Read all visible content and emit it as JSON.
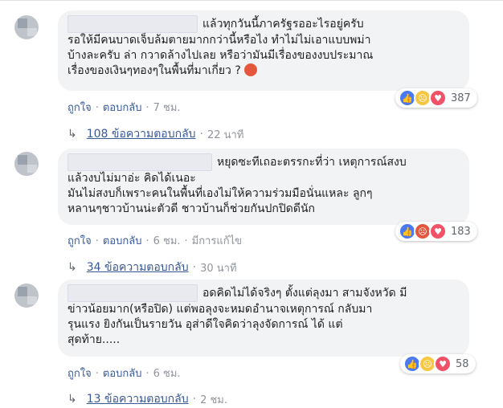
{
  "comments": [
    {
      "text": "แล้วทุกวันนี้ภาครัฐรออะไรอยู่ครับ\nรอให้มีคนบาดเจ็บล้มตายมากกว่านี้หรือไง ทำไม่ไม่เอาแบบพม่า\nบ้างละครับ ล่า กวาดล้างไปเลย หรือว่ามันมีเรื่องของงบประมาณ\nเรื่องของเงินๆทองๆในพื้นที่มาเกี่ยว ?",
      "like_label": "ถูกใจ",
      "reply_label": "ตอบกลับ",
      "time": "7 ชม.",
      "reaction_icons": [
        "like-icon",
        "sad-icon",
        "love-icon"
      ],
      "reaction_count": "387",
      "replies_label": "108 ข้อความตอบกลับ",
      "replies_time": "22 นาที"
    },
    {
      "text": "หยุดซะทีเถอะตรรกะที่ว่า เหตุการณ์สงบ\nแล้วงบไม่มาอ่ะ คิดได้เนอะ\nมันไม่สงบก็เพราะคนในพื้นที่เองไม่ให้ความร่วมมือนั่นแหละ ลูกๆ\nหลานๆชาวบ้านน่ะตัวดี ชาวบ้านก็ช่วยกันปกปิดดีนัก",
      "like_label": "ถูกใจ",
      "reply_label": "ตอบกลับ",
      "time": "6 ชม.",
      "edited_label": "มีการแก้ไข",
      "reaction_icons": [
        "like-icon",
        "angry-icon",
        "love-icon"
      ],
      "reaction_count": "183",
      "replies_label": "34 ข้อความตอบกลับ",
      "replies_time": "30 นาที"
    },
    {
      "text": "อดคิดไม่ได้จริงๆ ตั้งแต่ลุงมา สามจังหวัด มี\nข่าวน้อยมาก(หรือปิด) แต่พอลุงจะหมดอำนาจเหตุการณ์ กลับมา\nรุนแรง ยิงกันเป็นรายวัน อุส่าดีใจคิดว่าลุงจัดการณ์ ได้ แต่\nสุดท้าย.....",
      "like_label": "ถูกใจ",
      "reply_label": "ตอบกลับ",
      "time": "6 ชม.",
      "reaction_icons": [
        "like-icon",
        "sad-icon",
        "love-icon"
      ],
      "reaction_count": "58",
      "replies_label": "13 ข้อความตอบกลับ",
      "replies_time": "2 ชม."
    }
  ],
  "colors": {
    "link": "#385898",
    "bubble": "#f2f3f5",
    "meta": "#90949c"
  }
}
